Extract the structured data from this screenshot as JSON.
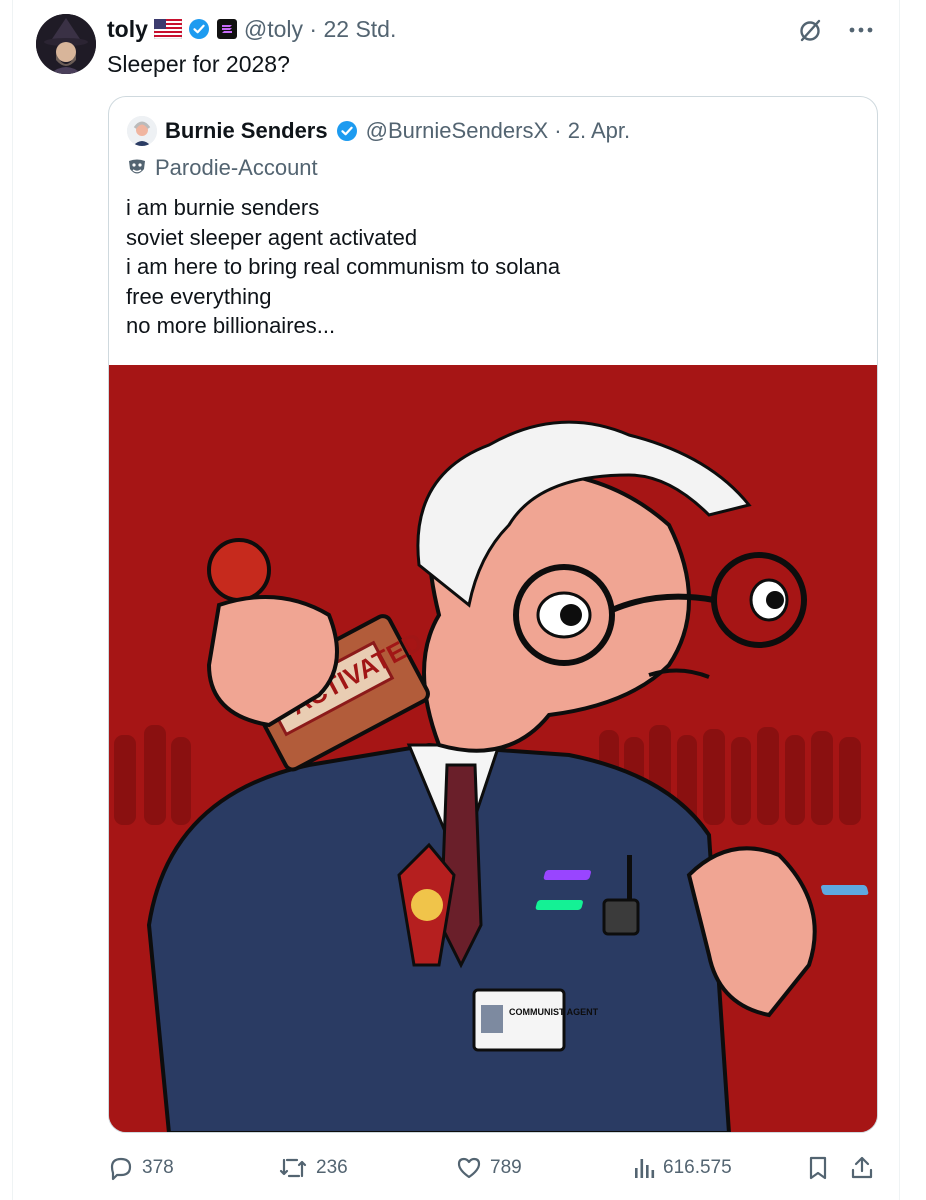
{
  "tweet": {
    "author_name": "toly",
    "handle_time": "@toly · 22 Std.",
    "text": "Sleeper for 2028?"
  },
  "quoted": {
    "author_name": "Burnie Senders",
    "handle_time": "@BurnieSendersX · 2. Apr.",
    "label": "Parodie-Account",
    "lines": [
      "i am burnie senders",
      "soviet sleeper agent activated",
      "i am here to bring real communism to solana",
      "free everything",
      "no more billionaires..."
    ],
    "media": {
      "stamp_text": "ACTIVATED",
      "id_card_text": "COMMUNIST AGENT"
    }
  },
  "actions": {
    "replies": "378",
    "reposts": "236",
    "likes": "789",
    "views": "616.575"
  },
  "colors": {
    "verified": "#1d9bf0",
    "muted": "#536471",
    "media_bg": "#a81616",
    "suit": "#2a3b63"
  }
}
